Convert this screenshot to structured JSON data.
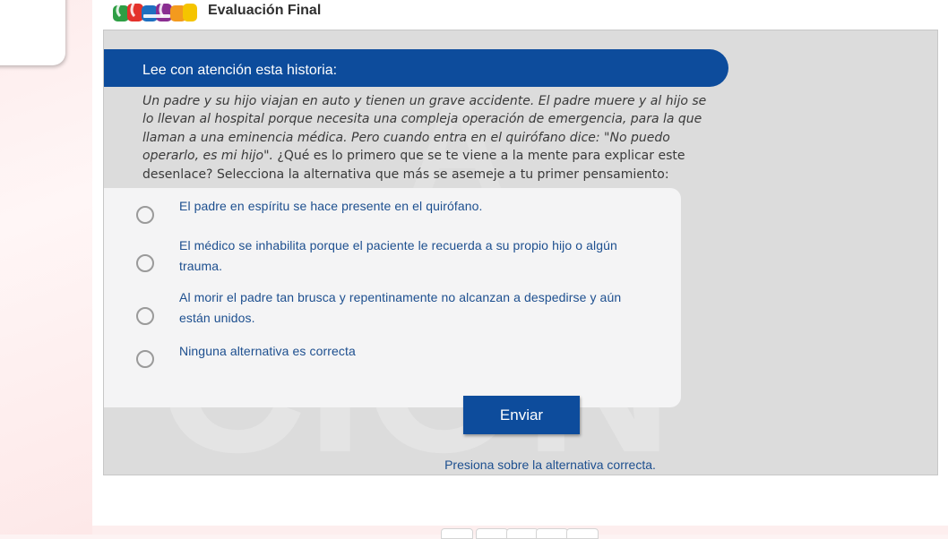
{
  "header": {
    "logo_text": "cerca",
    "title": "Evaluación Final"
  },
  "question": {
    "heading": "Lee con atención esta historia:",
    "story_italic": "Un padre y su hijo viajan en auto y tienen un grave accidente. El padre muere y al hijo se lo llevan al hospital porque necesita una compleja operación de emergencia, para la que llaman a una eminencia médica. Pero cuando entra en el quirófano dice: \"No puedo operarlo, es mi hijo\".",
    "story_prompt": "¿Qué es lo primero que se te viene a la mente para explicar este desenlace? Selecciona la alternativa que más se asemeje a tu primer pensamiento:"
  },
  "options": [
    {
      "label": "El padre en espíritu se hace presente en el quirófano.",
      "selected": false
    },
    {
      "label": "El médico se inhabilita porque el paciente le recuerda a su propio hijo o algún trauma.",
      "selected": false
    },
    {
      "label": "Al morir el padre tan brusca y repentinamente no alcanzan a despedirse y aún están unidos.",
      "selected": false
    },
    {
      "label": "Ninguna alternativa es correcta",
      "selected": false
    }
  ],
  "submit_label": "Enviar",
  "hint": "Presiona sobre la alternativa correcta.",
  "colors": {
    "primary": "#0d4c9c",
    "option_text": "#1d4f8f",
    "stage_bg": "#dcdcdc"
  }
}
